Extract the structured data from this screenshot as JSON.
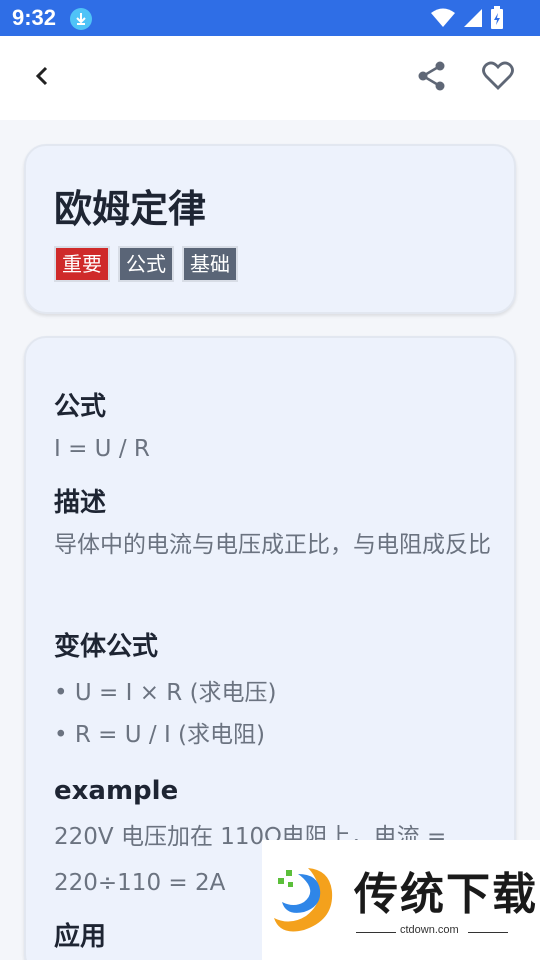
{
  "status_bar": {
    "time": "9:32"
  },
  "app_bar": {},
  "header": {
    "title": "欧姆定律",
    "tags": [
      "重要",
      "公式",
      "基础"
    ]
  },
  "sections": {
    "formula_heading": "公式",
    "formula": "I = U / R",
    "description_heading": "描述",
    "description": "导体中的电流与电压成正比，与电阻成反比",
    "variants_heading": "变体公式",
    "variant_1": "• U = I × R (求电压)",
    "variant_2": "• R = U / I (求电阻)",
    "example_heading": "example",
    "example": "220V 电压加在 110Ω电阻上，电流 = 220÷110 = 2A",
    "application_heading": "应用"
  },
  "watermark": {
    "title": "传统下载",
    "url": "ctdown.com"
  },
  "colors": {
    "primary": "#2f6ee6",
    "tag_red": "#cf2a2a",
    "tag_gray": "#5a6577"
  }
}
